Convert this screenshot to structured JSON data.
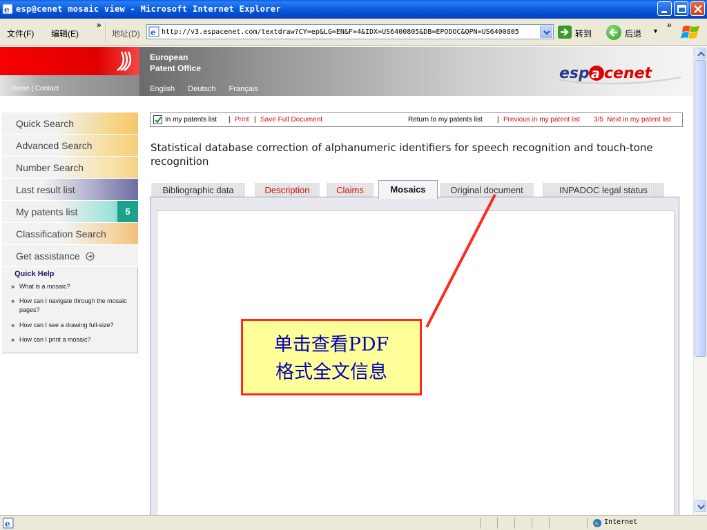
{
  "window": {
    "title": "esp@cenet mosaic view - Microsoft Internet Explorer"
  },
  "menubar": {
    "file": "文件(F)",
    "edit": "编辑(E)",
    "more": "»",
    "address_label": "地址(D)",
    "address_url": "http://v3.espacenet.com/textdraw?CY=ep&LG=EN&F=4&IDX=US6400805&DB=EPODOC&QPN=US6400805",
    "go_label": "转到",
    "back_label": "后退"
  },
  "header": {
    "epo_line1": "European",
    "epo_line2": "Patent Office",
    "home_contact": "Home | Contact",
    "languages": [
      "English",
      "Deutsch",
      "Français"
    ],
    "logo_text": "espacenet"
  },
  "sidebar": {
    "items": [
      {
        "label": "Quick Search"
      },
      {
        "label": "Advanced Search"
      },
      {
        "label": "Number Search"
      },
      {
        "label": "Last result list"
      },
      {
        "label": "My patents list",
        "badge": "5"
      },
      {
        "label": "Classification Search"
      },
      {
        "label": "Get assistance"
      }
    ],
    "quick_help": {
      "title": "Quick Help",
      "items": [
        "What is a mosaic?",
        "How can I navigate through the mosaic pages?",
        "How can I see a drawing full-size?",
        "How can I print a mosaic?"
      ]
    }
  },
  "toolbar": {
    "in_my_list": "In my patents list",
    "print": "Print",
    "save": "Save Full Document",
    "return": "Return to my patents list",
    "prev": "Previous in my patent list",
    "counter": "3/5",
    "next": "Next in my patent list",
    "sep": "|"
  },
  "patent": {
    "title": "Statistical database correction of alphanumeric identifiers for speech recognition and touch-tone recognition"
  },
  "tabs": [
    {
      "label": "Bibliographic data"
    },
    {
      "label": "Description"
    },
    {
      "label": "Claims"
    },
    {
      "label": "Mosaics"
    },
    {
      "label": "Original document"
    },
    {
      "label": "INPADOC legal status"
    }
  ],
  "callout": {
    "line1": "单击查看PDF",
    "line2": "格式全文信息"
  },
  "status": {
    "zone": "Internet"
  },
  "colors": {
    "annotation_border": "#ff2a1a",
    "annotation_bg": "#ffff99",
    "annotation_text": "#0000b5",
    "link_red": "#d01010",
    "epo_red": "#e00000"
  }
}
